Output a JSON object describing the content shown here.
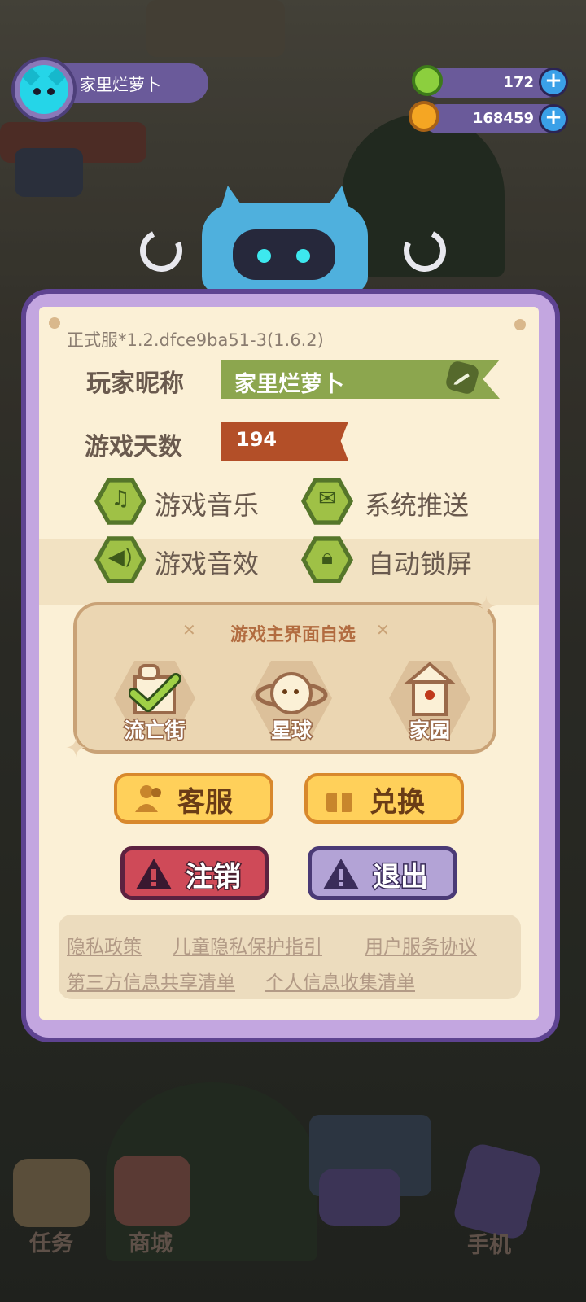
{
  "hud": {
    "player_name": "家里烂萝卜",
    "donut_count": "172",
    "coin_count": "168459"
  },
  "settings": {
    "version": "正式服*1.2.dfce9ba51-3(1.6.2)",
    "nickname_label": "玩家昵称",
    "nickname_value": "家里烂萝卜",
    "days_label": "游戏天数",
    "days_value": "194",
    "options": {
      "music": "游戏音乐",
      "push": "系统推送",
      "sfx": "游戏音效",
      "lock": "自动锁屏"
    },
    "main_screen": {
      "title": "游戏主界面自选",
      "choices": [
        "流亡街",
        "星球",
        "家园"
      ],
      "selected": "流亡街"
    },
    "buttons": {
      "support": "客服",
      "redeem": "兑换",
      "cancel_account": "注销",
      "logout": "退出"
    },
    "links": [
      "隐私政策",
      "儿童隐私保护指引",
      "用户服务协议",
      "第三方信息共享清单",
      "个人信息收集清单"
    ]
  },
  "bottom_nav": {
    "tasks": "任务",
    "shop": "商城",
    "phone": "手机"
  },
  "colors": {
    "panel_border": "#5e4391",
    "paper": "#fbf0d6",
    "nickname_banner": "#8ca64e",
    "days_banner": "#b34f28",
    "gold_button": "#ffd05a",
    "red_button": "#cf4a58",
    "purple_button": "#b3a3d6"
  }
}
